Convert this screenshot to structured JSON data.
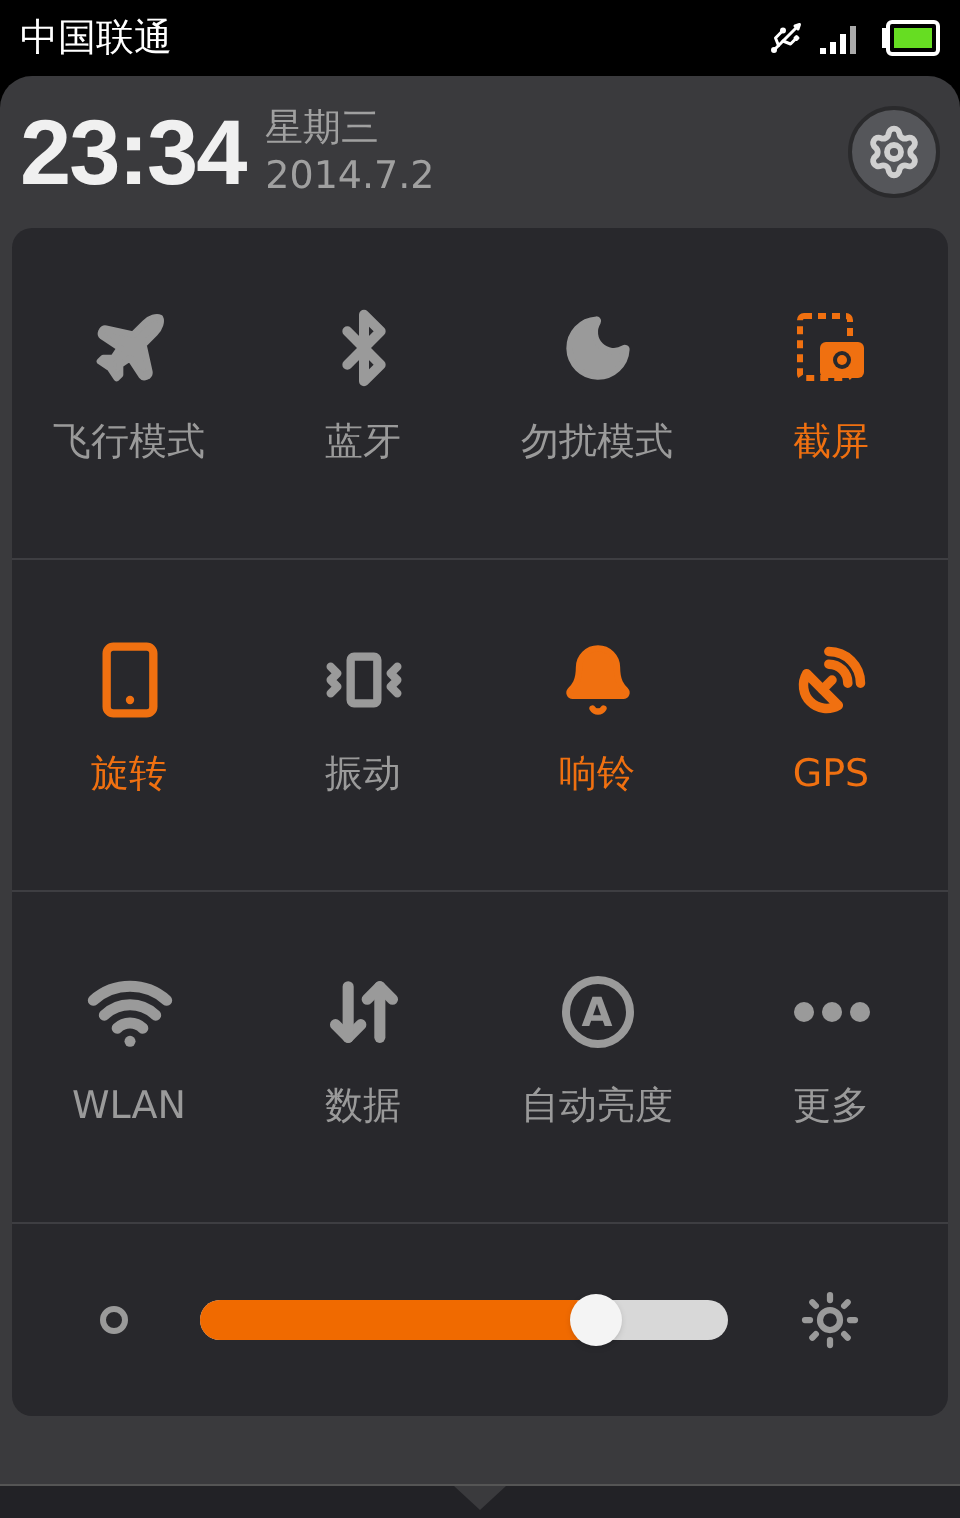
{
  "status_bar": {
    "carrier": "中国联通"
  },
  "header": {
    "time": "23:34",
    "weekday": "星期三",
    "date": "2014.7.2"
  },
  "toggles": [
    {
      "label": "飞行模式",
      "kind": "airplane",
      "on": false
    },
    {
      "label": "蓝牙",
      "kind": "bluetooth",
      "on": false
    },
    {
      "label": "勿扰模式",
      "kind": "moon",
      "on": false
    },
    {
      "label": "截屏",
      "kind": "screenshot",
      "on": true
    },
    {
      "label": "旋转",
      "kind": "rotate",
      "on": true
    },
    {
      "label": "振动",
      "kind": "vibrate",
      "on": false
    },
    {
      "label": "响铃",
      "kind": "bell",
      "on": true
    },
    {
      "label": "GPS",
      "kind": "gps",
      "on": true
    },
    {
      "label": "WLAN",
      "kind": "wifi",
      "on": false
    },
    {
      "label": "数据",
      "kind": "data",
      "on": false
    },
    {
      "label": "自动亮度",
      "kind": "auto",
      "glyph": "A",
      "on": false
    },
    {
      "label": "更多",
      "kind": "more",
      "on": false
    }
  ],
  "brightness": {
    "level": 0.75
  }
}
